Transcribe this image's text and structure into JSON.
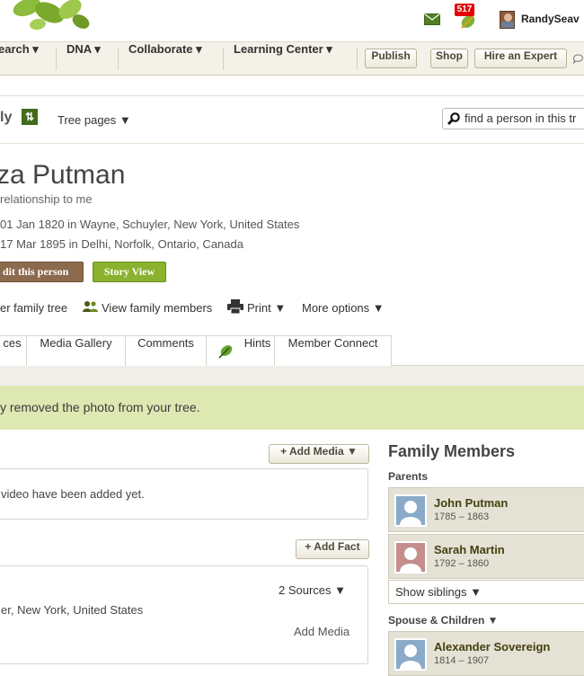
{
  "header": {
    "notification_count": "517",
    "user_name": "RandySeav"
  },
  "nav": {
    "items": [
      "earch ▾",
      "DNA ▾",
      "Collaborate ▾",
      "Learning Center ▾"
    ],
    "buttons": [
      "Publish",
      "Shop",
      "Hire an Expert"
    ]
  },
  "tree_bar": {
    "tree_name": "ly",
    "tree_pages": "Tree pages ▼",
    "find_placeholder": "find a person in this tr"
  },
  "person": {
    "name": "za Putman",
    "relationship": "relationship to me",
    "birth": "01 Jan 1820 in Wayne, Schuyler, New York, United States",
    "death": "17 Mar 1895 in Delhi, Norfolk, Ontario, Canada",
    "edit_label": "dit this person",
    "story_label": "Story View"
  },
  "options": {
    "tree": "er family tree",
    "members": "View family members",
    "print": "Print ▼",
    "more": "More options ▼"
  },
  "tabs": [
    "ces",
    "Media Gallery",
    "Comments",
    "Hints",
    "Member Connect"
  ],
  "alert": "y removed the photo from your tree.",
  "media": {
    "add_label": "+ Add Media ▼",
    "empty_text": "video have been added yet."
  },
  "facts": {
    "add_label": "+ Add Fact",
    "sources": "2 Sources ▼",
    "place": "er, New York, United States",
    "add_media": "Add Media"
  },
  "family": {
    "title": "Family Members",
    "parents_label": "Parents",
    "parents": [
      {
        "name": "John Putman",
        "dates": "1785 – 1863",
        "gender": "male"
      },
      {
        "name": "Sarah Martin",
        "dates": "1792 – 1860",
        "gender": "female"
      }
    ],
    "show_siblings": "Show siblings ▼",
    "spouse_label": "Spouse & Children ▼",
    "spouses": [
      {
        "name": "Alexander Sovereign",
        "dates": "1814 – 1907",
        "gender": "male"
      }
    ]
  },
  "colors": {
    "accent_green": "#8ab22e",
    "edit_brown": "#8c6a4d",
    "alert_bg": "#dde8b2",
    "male_silhouette": "#8aaac9",
    "female_silhouette": "#c48e8c"
  }
}
